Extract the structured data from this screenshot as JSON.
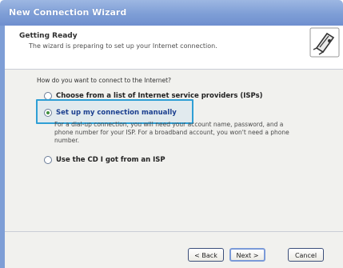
{
  "window": {
    "title": "New Connection Wizard"
  },
  "header": {
    "title": "Getting Ready",
    "subtitle": "The wizard is preparing to set up your Internet connection.",
    "icon": "wizard-connection-icon"
  },
  "main": {
    "question": "How do you want to connect to the Internet?",
    "options": [
      {
        "label": "Choose from a list of Internet service providers (ISPs)",
        "selected": false
      },
      {
        "label": "Set up my connection manually",
        "selected": true
      },
      {
        "label": "Use the CD I got from an ISP",
        "selected": false
      }
    ],
    "manual_description": "For a dial-up connection, you will need your account name, password, and a phone number for your ISP. For a broadband account, you won't need a phone number."
  },
  "buttons": {
    "back": "< Back",
    "next": "Next >",
    "cancel": "Cancel"
  },
  "colors": {
    "titlebar": "#7e9ed6",
    "highlight_border": "#2f9fd5",
    "dialog_bg": "#f1f1ee"
  }
}
